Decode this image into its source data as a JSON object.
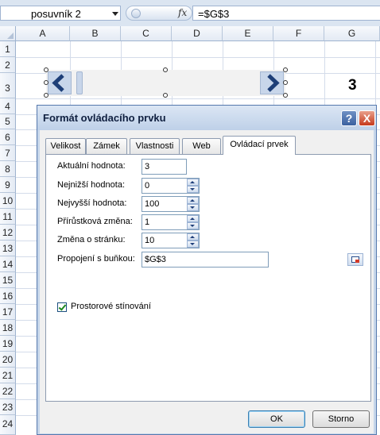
{
  "formula_bar": {
    "name_box": "posuvník 2",
    "fx": "fx",
    "formula": "=$G$3"
  },
  "columns": [
    "A",
    "B",
    "C",
    "D",
    "E",
    "F",
    "G"
  ],
  "rows": [
    "1",
    "2",
    "3",
    "4",
    "5",
    "6",
    "7",
    "8",
    "9",
    "10",
    "11",
    "12",
    "13",
    "14",
    "15",
    "16",
    "17",
    "18",
    "19",
    "20",
    "21",
    "22",
    "23",
    "24"
  ],
  "cells": {
    "G3": "3"
  },
  "dialog": {
    "title": "Formát ovládacího prvku",
    "help": "?",
    "close": "X",
    "tabs": [
      {
        "label": "Velikost",
        "active": false
      },
      {
        "label": "Zámek",
        "active": false
      },
      {
        "label": "Vlastnosti",
        "active": false
      },
      {
        "label": "Web",
        "active": false
      },
      {
        "label": "Ovládací prvek",
        "active": true
      }
    ],
    "fields": {
      "current_label": "Aktuální hodnota:",
      "current_value": "3",
      "min_label": "Nejnižší hodnota:",
      "min_value": "0",
      "max_label": "Nejvyšší hodnota:",
      "max_value": "100",
      "inc_label": "Přírůstková změna:",
      "inc_value": "1",
      "page_label": "Změna o stránku:",
      "page_value": "10",
      "link_label": "Propojení s buňkou:",
      "link_value": "$G$3"
    },
    "shading_label": "Prostorové stínování",
    "shading_checked": true,
    "ok_label": "OK",
    "cancel_label": "Storno"
  }
}
